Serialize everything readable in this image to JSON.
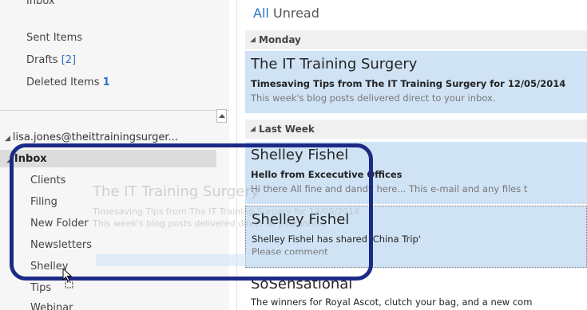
{
  "folders": {
    "top_partial": "Inbox",
    "sent": "Sent Items",
    "drafts_label": "Drafts",
    "drafts_count": "[2]",
    "deleted_label": "Deleted Items",
    "deleted_count": "1",
    "account": "lisa.jones@theittrainingsurger...",
    "inbox": "Inbox",
    "subfolders": [
      "Clients",
      "Filing",
      "New Folder",
      "Newsletters",
      "Shelley",
      "Tips",
      "Webinar"
    ]
  },
  "filters": {
    "all": "All",
    "unread": "Unread"
  },
  "groups": {
    "monday": "Monday",
    "last_week": "Last Week"
  },
  "mails": [
    {
      "sender": "The IT Training Surgery",
      "subject": "Timesaving Tips from  The IT Training Surgery for 12/05/2014",
      "preview": "This week's blog posts delivered direct to your inbox."
    },
    {
      "sender": "Shelley Fishel",
      "subject": "Hello from Excecutive Offices",
      "preview": "Hi there  All fine and dandy here...  This e-mail and any files t"
    },
    {
      "sender": "Shelley Fishel",
      "subject": "Shelley Fishel has shared 'China Trip'",
      "preview": "Please comment"
    },
    {
      "sender": "SoSensational",
      "subject": "The winners for Royal Ascot, clutch your bag, and a new com",
      "preview": ""
    }
  ],
  "drag_ghost": {
    "sender": "The IT Training Surgery",
    "subject": "Timesaving Tips from  The IT Training Surgery for 12/05/2014",
    "preview": "This week's blog posts delivered direct to your inbox."
  },
  "colors": {
    "accent": "#2a72c9",
    "selection": "#cfe3f5",
    "ring": "#1c2a86"
  }
}
